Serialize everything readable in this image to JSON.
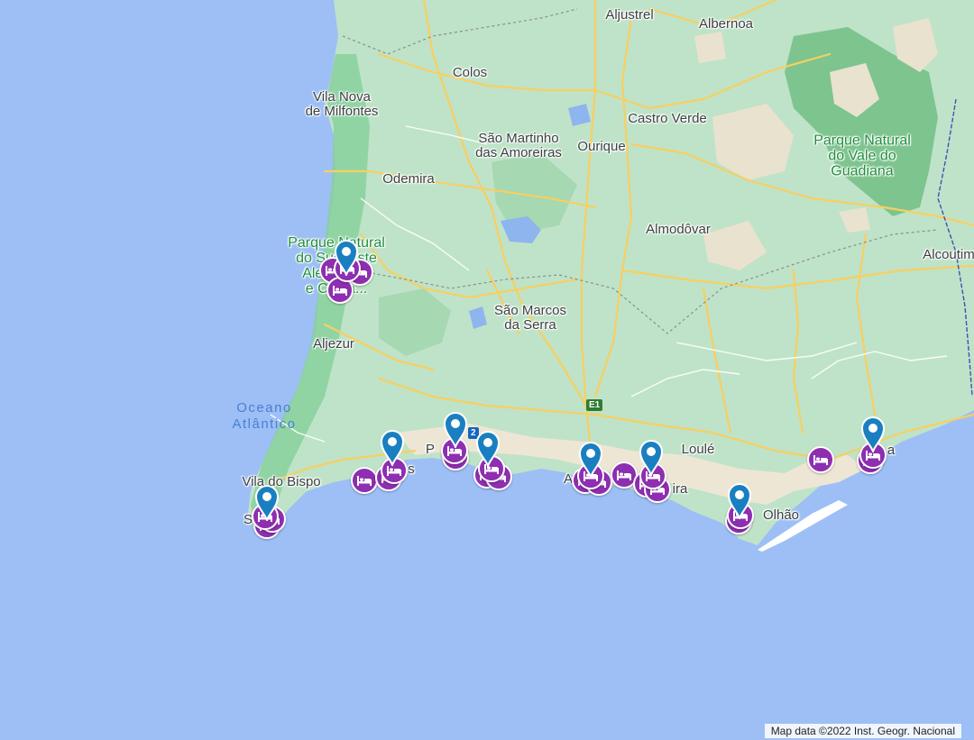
{
  "map": {
    "colors": {
      "ocean": "#9dbff5",
      "land": "#bfe3c8",
      "park": "#86cf9b",
      "urban": "#eee6d5",
      "road": "#f7cf62",
      "hotel_marker": "#8e2eb0",
      "pin": "#1a7fc1"
    },
    "places": [
      {
        "id": "aljustrel",
        "name": "Aljustrel",
        "kind": "city"
      },
      {
        "id": "albernoa",
        "name": "Albernoa",
        "kind": "city"
      },
      {
        "id": "colos",
        "name": "Colos",
        "kind": "city"
      },
      {
        "id": "vila-nova",
        "name": "Vila Nova\nde Milfontes",
        "kind": "city"
      },
      {
        "id": "castro-verde",
        "name": "Castro Verde",
        "kind": "city"
      },
      {
        "id": "sao-martinho",
        "name": "São Martinho\ndas Amoreiras",
        "kind": "city"
      },
      {
        "id": "ourique",
        "name": "Ourique",
        "kind": "city"
      },
      {
        "id": "parque-guadiana",
        "name": "Parque Natural\ndo Vale do\nGuadiana",
        "kind": "park"
      },
      {
        "id": "odemira",
        "name": "Odemira",
        "kind": "city"
      },
      {
        "id": "almodovar",
        "name": "Almodôvar",
        "kind": "city"
      },
      {
        "id": "parque-sudoeste",
        "name": "Parque Natural\ndo Sudoeste\nAlentejano\ne Costa...",
        "kind": "park"
      },
      {
        "id": "alcoutim",
        "name": "Alcoutim",
        "kind": "city"
      },
      {
        "id": "sao-marcos",
        "name": "São Marcos\nda Serra",
        "kind": "city"
      },
      {
        "id": "aljezur",
        "name": "Aljezur",
        "kind": "city"
      },
      {
        "id": "oceano",
        "name": "Oceano\nAtlântico",
        "kind": "ocean"
      },
      {
        "id": "loule",
        "name": "Loulé",
        "kind": "city"
      },
      {
        "id": "vila-do-bispo",
        "name": "Vila do Bispo",
        "kind": "city"
      },
      {
        "id": "olhao",
        "name": "Olhão",
        "kind": "city"
      },
      {
        "id": "lagos-frag",
        "name": "s",
        "kind": "city"
      },
      {
        "id": "portimao-frag",
        "name": "P",
        "kind": "city"
      },
      {
        "id": "albufeira-frag",
        "name": "A",
        "kind": "city"
      },
      {
        "id": "quarteira-frag",
        "name": "ira",
        "kind": "city"
      },
      {
        "id": "sagres-frag",
        "name": "S",
        "kind": "city"
      },
      {
        "id": "tavira-frag",
        "name": "a",
        "kind": "city"
      }
    ],
    "road_shield": "E1",
    "road_shield_small": "2",
    "markers": {
      "hotel_icon": "bed-icon",
      "pin_icon": "map-pin-icon",
      "hotel_count": 27,
      "pin_count": 10
    },
    "attribution": "Map data ©2022 Inst. Geogr. Nacional"
  }
}
